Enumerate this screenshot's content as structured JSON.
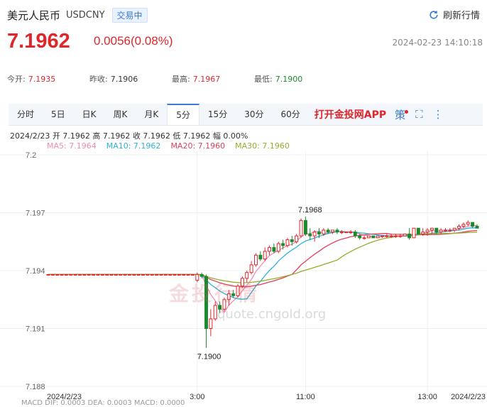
{
  "header": {
    "name": "美元人民币",
    "code": "USDCNY",
    "status": "交易中",
    "refresh_label": "刷新行情"
  },
  "quote": {
    "price": "7.1962",
    "change": "0.0056(0.08%)",
    "timestamp": "2024-02-23 14:10:18"
  },
  "stats": [
    {
      "label": "今开:",
      "value": "7.1935",
      "color": "#e0262b"
    },
    {
      "label": "昨收:",
      "value": "7.1906",
      "color": "#333333"
    },
    {
      "label": "最高:",
      "value": "7.1967",
      "color": "#e0262b"
    },
    {
      "label": "最低:",
      "value": "7.1900",
      "color": "#1b8a2e"
    }
  ],
  "tabs": {
    "items": [
      "分时",
      "5日",
      "日K",
      "周K",
      "月K",
      "5分",
      "15分",
      "30分",
      "60分"
    ],
    "active_index": 5,
    "app_link": "打开金投网APP",
    "strategy_label": "策"
  },
  "ohlc_line": "2024/2/23  开 7.1962  高 7.1962  收 7.1962  低 7.1962  幅 0.00%",
  "ma_legend": [
    {
      "label": "MA5: 7.1964",
      "color": "#f08cb4"
    },
    {
      "label": "MA10: 7.1962",
      "color": "#2bb3d6"
    },
    {
      "label": "MA20: 7.1960",
      "color": "#e0405a"
    },
    {
      "label": "MA30: 7.1960",
      "color": "#9aaa2a"
    }
  ],
  "watermark": {
    "text": "金投行情",
    "url": "quote.cngold.org"
  },
  "bottom_partial": "MACD  DIF: 0.0003     DEA: 0.0003     MACD: 0.0000",
  "colors": {
    "up": "#e0262b",
    "down": "#1b8a2e",
    "accent": "#3a7bd5"
  },
  "chart_data": {
    "type": "candlestick",
    "ylim": [
      7.188,
      7.2
    ],
    "yticks": [
      "7.2",
      "7.197",
      "7.194",
      "7.191",
      "7.188"
    ],
    "xticks": [
      {
        "label": "2024/2/23",
        "index": 0
      },
      {
        "label": "3:00",
        "index": 33
      },
      {
        "label": "11:00",
        "index": 57
      },
      {
        "label": "13:00",
        "index": 84
      },
      {
        "label": "2024/2/23",
        "index": 99
      }
    ],
    "high_label": {
      "value": "7.1968",
      "index": 58
    },
    "low_label": {
      "value": "7.1900",
      "index": 35
    },
    "candles": [
      [
        7.1938,
        7.1938,
        7.1938,
        7.1938
      ],
      [
        7.1938,
        7.1938,
        7.1938,
        7.1938
      ],
      [
        7.1938,
        7.1938,
        7.1938,
        7.1938
      ],
      [
        7.1938,
        7.1938,
        7.1938,
        7.1938
      ],
      [
        7.1938,
        7.1938,
        7.1938,
        7.1938
      ],
      [
        7.1938,
        7.1938,
        7.1938,
        7.1938
      ],
      [
        7.1938,
        7.1938,
        7.1938,
        7.1938
      ],
      [
        7.1938,
        7.1938,
        7.1938,
        7.1938
      ],
      [
        7.1938,
        7.1938,
        7.1938,
        7.1938
      ],
      [
        7.1938,
        7.1938,
        7.1938,
        7.1938
      ],
      [
        7.1938,
        7.1938,
        7.1938,
        7.1938
      ],
      [
        7.1938,
        7.1938,
        7.1938,
        7.1938
      ],
      [
        7.1938,
        7.1938,
        7.1938,
        7.1938
      ],
      [
        7.1938,
        7.1938,
        7.1938,
        7.1938
      ],
      [
        7.1938,
        7.1938,
        7.1938,
        7.1938
      ],
      [
        7.1938,
        7.1938,
        7.1938,
        7.1938
      ],
      [
        7.1938,
        7.1938,
        7.1938,
        7.1938
      ],
      [
        7.1938,
        7.1938,
        7.1938,
        7.1938
      ],
      [
        7.1938,
        7.1938,
        7.1938,
        7.1938
      ],
      [
        7.1938,
        7.1938,
        7.1938,
        7.1938
      ],
      [
        7.1938,
        7.1938,
        7.1938,
        7.1938
      ],
      [
        7.1938,
        7.1938,
        7.1938,
        7.1938
      ],
      [
        7.1938,
        7.1938,
        7.1938,
        7.1938
      ],
      [
        7.1938,
        7.1938,
        7.1938,
        7.1938
      ],
      [
        7.1938,
        7.1938,
        7.1938,
        7.1938
      ],
      [
        7.1938,
        7.1938,
        7.1938,
        7.1938
      ],
      [
        7.1938,
        7.1938,
        7.1938,
        7.1938
      ],
      [
        7.1938,
        7.1938,
        7.1938,
        7.1938
      ],
      [
        7.1938,
        7.1938,
        7.1938,
        7.1938
      ],
      [
        7.1938,
        7.1938,
        7.1938,
        7.1938
      ],
      [
        7.1938,
        7.1938,
        7.1938,
        7.1938
      ],
      [
        7.1938,
        7.1938,
        7.1938,
        7.1938
      ],
      [
        7.1938,
        7.1938,
        7.1938,
        7.1938
      ],
      [
        7.1935,
        7.1939,
        7.1934,
        7.1938
      ],
      [
        7.1938,
        7.1939,
        7.1936,
        7.1937
      ],
      [
        7.1937,
        7.1938,
        7.19,
        7.191
      ],
      [
        7.191,
        7.192,
        7.1906,
        7.1915
      ],
      [
        7.1915,
        7.1924,
        7.1914,
        7.1922
      ],
      [
        7.1922,
        7.1924,
        7.1918,
        7.192
      ],
      [
        7.192,
        7.1926,
        7.1919,
        7.1925
      ],
      [
        7.1925,
        7.193,
        7.1922,
        7.1928
      ],
      [
        7.1928,
        7.193,
        7.1926,
        7.1927
      ],
      [
        7.1927,
        7.1933,
        7.1926,
        7.1932
      ],
      [
        7.1932,
        7.1937,
        7.1931,
        7.1936
      ],
      [
        7.1936,
        7.194,
        7.1934,
        7.1939
      ],
      [
        7.1939,
        7.1945,
        7.1938,
        7.1943
      ],
      [
        7.1943,
        7.1949,
        7.1942,
        7.1948
      ],
      [
        7.1948,
        7.195,
        7.1945,
        7.1946
      ],
      [
        7.1946,
        7.1952,
        7.1945,
        7.195
      ],
      [
        7.195,
        7.1953,
        7.1948,
        7.1952
      ],
      [
        7.1952,
        7.1954,
        7.1949,
        7.195
      ],
      [
        7.195,
        7.1955,
        7.1949,
        7.1954
      ],
      [
        7.1954,
        7.1956,
        7.1951,
        7.1953
      ],
      [
        7.1953,
        7.1957,
        7.1952,
        7.1956
      ],
      [
        7.1956,
        7.1958,
        7.1953,
        7.1955
      ],
      [
        7.1955,
        7.1959,
        7.1954,
        7.1958
      ],
      [
        7.1958,
        7.1967,
        7.1957,
        7.1966
      ],
      [
        7.1966,
        7.1968,
        7.1958,
        7.1959
      ],
      [
        7.1959,
        7.1962,
        7.1956,
        7.1958
      ],
      [
        7.1958,
        7.1961,
        7.1955,
        7.196
      ],
      [
        7.196,
        7.1962,
        7.1957,
        7.1959
      ],
      [
        7.1959,
        7.1962,
        7.1958,
        7.1961
      ],
      [
        7.1961,
        7.1962,
        7.1959,
        7.196
      ],
      [
        7.196,
        7.1961,
        7.1959,
        7.1961
      ],
      [
        7.1961,
        7.1962,
        7.1959,
        7.196
      ],
      [
        7.196,
        7.1961,
        7.1959,
        7.196
      ],
      [
        7.196,
        7.196,
        7.196,
        7.196
      ],
      [
        7.196,
        7.1961,
        7.1959,
        7.196
      ],
      [
        7.196,
        7.1961,
        7.1957,
        7.1958
      ],
      [
        7.1958,
        7.1959,
        7.1956,
        7.1957
      ],
      [
        7.1957,
        7.1958,
        7.1956,
        7.1957
      ],
      [
        7.1957,
        7.1958,
        7.1957,
        7.1958
      ],
      [
        7.1958,
        7.1958,
        7.1957,
        7.1957
      ],
      [
        7.1957,
        7.1958,
        7.1957,
        7.1958
      ],
      [
        7.1958,
        7.1958,
        7.1957,
        7.1958
      ],
      [
        7.1958,
        7.1959,
        7.1957,
        7.1958
      ],
      [
        7.1958,
        7.1959,
        7.1957,
        7.1958
      ],
      [
        7.1958,
        7.1959,
        7.1957,
        7.1958
      ],
      [
        7.1958,
        7.1959,
        7.1957,
        7.1958
      ],
      [
        7.1958,
        7.1959,
        7.1958,
        7.1959
      ],
      [
        7.1959,
        7.1962,
        7.1956,
        7.1957
      ],
      [
        7.1957,
        7.1962,
        7.1957,
        7.1962
      ],
      [
        7.1962,
        7.1962,
        7.1959,
        7.1959
      ],
      [
        7.1959,
        7.1962,
        7.1958,
        7.196
      ],
      [
        7.196,
        7.1962,
        7.1958,
        7.1961
      ],
      [
        7.1961,
        7.1962,
        7.1959,
        7.1962
      ],
      [
        7.1962,
        7.1962,
        7.1959,
        7.196
      ],
      [
        7.196,
        7.1962,
        7.1959,
        7.1961
      ],
      [
        7.1961,
        7.1962,
        7.196,
        7.1961
      ],
      [
        7.1961,
        7.1962,
        7.196,
        7.1961
      ],
      [
        7.1961,
        7.1962,
        7.196,
        7.1962
      ],
      [
        7.1962,
        7.1964,
        7.1961,
        7.1963
      ],
      [
        7.1963,
        7.1965,
        7.1962,
        7.1964
      ],
      [
        7.1964,
        7.1966,
        7.1963,
        7.1965
      ],
      [
        7.1965,
        7.1965,
        7.1962,
        7.1963
      ],
      [
        7.1963,
        7.1964,
        7.1962,
        7.1962
      ]
    ],
    "series": [
      {
        "name": "MA5",
        "color": "#f08cb4"
      },
      {
        "name": "MA10",
        "color": "#2bb3d6"
      },
      {
        "name": "MA20",
        "color": "#e0405a"
      },
      {
        "name": "MA30",
        "color": "#9aaa2a"
      }
    ]
  }
}
